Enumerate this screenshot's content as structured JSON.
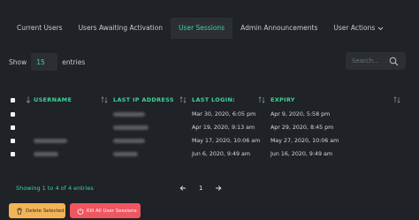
{
  "tabs": [
    {
      "label": "Current Users"
    },
    {
      "label": "Users Awaiting Activation"
    },
    {
      "label": "User Sessions"
    },
    {
      "label": "Admin Announcements"
    },
    {
      "label": "User Actions"
    }
  ],
  "active_tab": "User Sessions",
  "length_control": {
    "prefix": "Show",
    "value": "15",
    "suffix": "entries"
  },
  "search": {
    "placeholder": "Search..."
  },
  "table": {
    "headers": [
      "USERNAME",
      "LAST IP ADDRESS",
      "LAST LOGIN:",
      "EXPIRY"
    ],
    "rows": [
      {
        "last_login": "Mar 30, 2020, 6:05 pm",
        "expiry": "Apr 9, 2020, 5:58 pm"
      },
      {
        "last_login": "Apr 19, 2020, 9:13 am",
        "expiry": "Apr 29, 2020, 8:45 pm"
      },
      {
        "last_login": "May 17, 2020, 10:06 am",
        "expiry": "May 27, 2020, 10:06 am"
      },
      {
        "last_login": "Jun 6, 2020, 9:49 am",
        "expiry": "Jun 16, 2020, 9:49 am"
      }
    ]
  },
  "info": "Showing 1 to 4 of 4 entries",
  "pagination": {
    "current": "1"
  },
  "buttons": {
    "delete": "Delete Selected",
    "kill": "Kill All User Sessions"
  },
  "colors": {
    "accent": "#3fd39a",
    "background": "#1f2226",
    "panel": "#2b2f34",
    "warning": "#f3b456",
    "danger": "#ef5660"
  }
}
